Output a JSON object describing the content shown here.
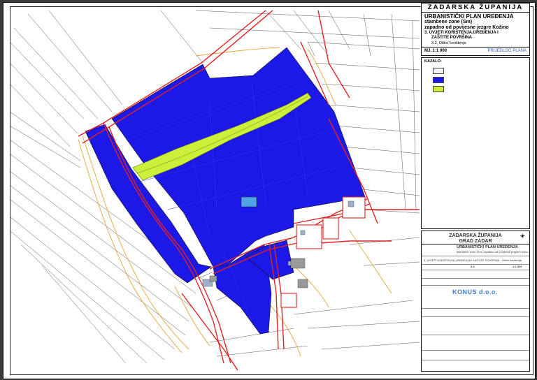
{
  "title_block": {
    "county": "ZADARSKA ŽUPANIJA",
    "plan_title": "URBANISTIČKI PLAN UREĐENJA",
    "plan_sub1": "stambene zone (Sm)",
    "plan_sub2": "zapadno od povijesne jezgre Kožino",
    "section": "3. UVJETI KORIŠTENJA,UREĐENJA I",
    "section2": "ZAŠTITE POVRŠINA",
    "subsection": "3.2. Oblici korištenja",
    "scale": "MJ. 1:1 000",
    "status": "PRIJEDLOG PLANA"
  },
  "legend": {
    "title": "KAZALO:",
    "items": [
      {
        "label": "",
        "color": "#f4f4f4"
      },
      {
        "label": "",
        "color": "#1c18e8"
      },
      {
        "label": "",
        "color": "#ccf03a"
      }
    ]
  },
  "info_block": {
    "county": "ZADARSKA ŽUPANIJA",
    "city": "GRAD ZADAR",
    "plan_title": "URBANISTIČKI PLAN UREĐENJA",
    "plan_sub": "stambene zone (Sm) zapadno od povijesne jezgre Kožino",
    "section": "3. UVJETI KORIŠTENJA,UREĐENJA I ZAŠTITE POVRŠINA - Oblici korištenja",
    "map_no": "3.2.",
    "scale": "1:1 000",
    "company": "KONUS d.o.o."
  },
  "colors": {
    "zone_blue": "#1c18e8",
    "green_strip": "#ccf03a",
    "road_red": "#e32222",
    "contour_orange": "#e8a43a"
  }
}
